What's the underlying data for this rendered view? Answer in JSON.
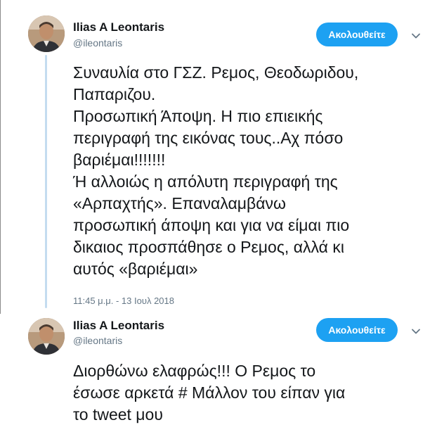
{
  "tweets": [
    {
      "display_name": "Ilias A Leontaris",
      "handle": "@ileontaris",
      "follow_label": "Ακολουθείτε",
      "text": "Συναυλία στο ΓΣΖ. Ρεμος, Θεοδωριδου,\nΠαπαριζου.\nΠροσωπική Άποψη. Η πιο επιεικής\nπεριγραφή της εικόνας τους..Αχ πόσο\nβαριέμαι!!!!!!!\nΉ αλλοιώς η απόλυτη περιγραφή της\n«Αρπαχτής». Επαναλαμβάνω\nπροσωπική άποψη και για να είμαι πιο\nδικαιος προσπάθησε ο Ρεμος, αλλά κι\nαυτός «βαριέμαι»",
      "timestamp": "11:45 μ.μ. - 13 Ιουλ 2018"
    },
    {
      "display_name": "Ilias A Leontaris",
      "handle": "@ileontaris",
      "follow_label": "Ακολουθείτε",
      "text": "Διορθώνω ελαφρώς!!! Ο Ρεμος το\nέσωσε αρκετά # Μάλλον του είπαν για\nτο tweet μου"
    }
  ],
  "colors": {
    "accent": "#1da1f2",
    "thread_line": "#c4dcf0",
    "secondary_text": "#657786",
    "primary_text": "#14171a"
  },
  "icons": {
    "menu": "chevron-down-icon",
    "avatar": "profile-photo"
  }
}
